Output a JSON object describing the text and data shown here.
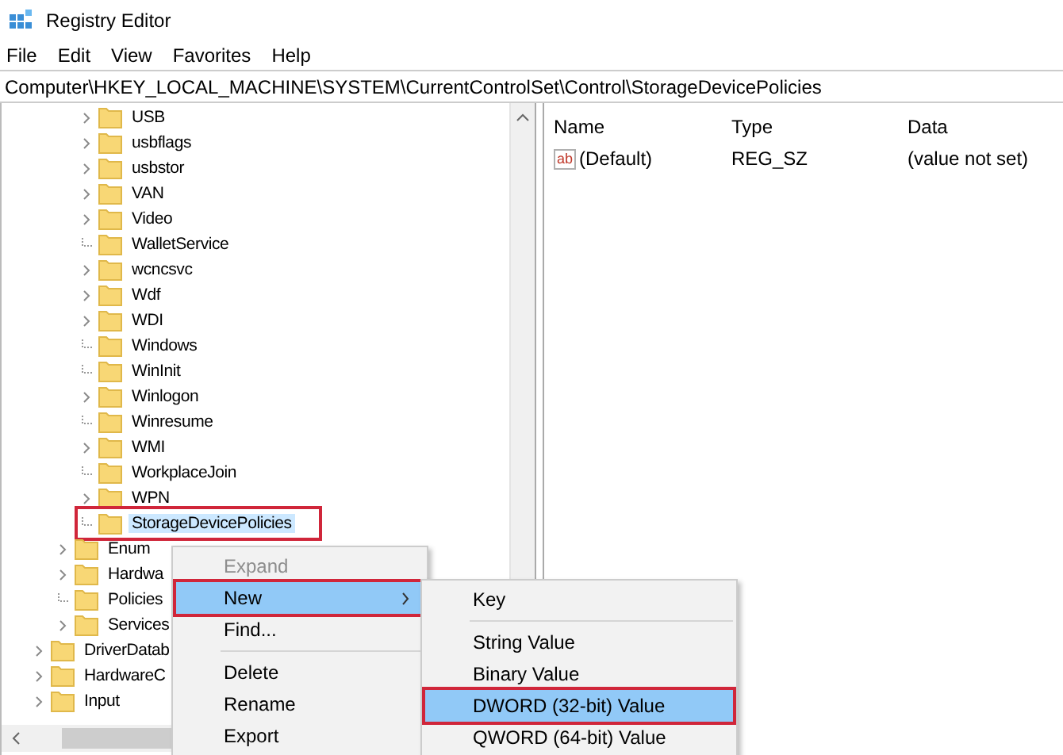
{
  "window": {
    "title": "Registry Editor"
  },
  "menu_bar": [
    "File",
    "Edit",
    "View",
    "Favorites",
    "Help"
  ],
  "address": "Computer\\HKEY_LOCAL_MACHINE\\SYSTEM\\CurrentControlSet\\Control\\StorageDevicePolicies",
  "tree": {
    "children": [
      {
        "children": [
          {
            "children": [
              {
                "label": "USB",
                "expandable": true,
                "selected": false,
                "outlined": false
              },
              {
                "label": "usbflags",
                "expandable": true,
                "selected": false,
                "outlined": false
              },
              {
                "label": "usbstor",
                "expandable": true,
                "selected": false,
                "outlined": false
              },
              {
                "label": "VAN",
                "expandable": true,
                "selected": false,
                "outlined": false
              },
              {
                "label": "Video",
                "expandable": true,
                "selected": false,
                "outlined": false
              },
              {
                "label": "WalletService",
                "expandable": false,
                "selected": false,
                "outlined": false
              },
              {
                "label": "wcncsvc",
                "expandable": true,
                "selected": false,
                "outlined": false
              },
              {
                "label": "Wdf",
                "expandable": true,
                "selected": false,
                "outlined": false
              },
              {
                "label": "WDI",
                "expandable": true,
                "selected": false,
                "outlined": false
              },
              {
                "label": "Windows",
                "expandable": false,
                "selected": false,
                "outlined": false
              },
              {
                "label": "WinInit",
                "expandable": false,
                "selected": false,
                "outlined": false
              },
              {
                "label": "Winlogon",
                "expandable": true,
                "selected": false,
                "outlined": false
              },
              {
                "label": "Winresume",
                "expandable": false,
                "selected": false,
                "outlined": false
              },
              {
                "label": "WMI",
                "expandable": true,
                "selected": false,
                "outlined": false
              },
              {
                "label": "WorkplaceJoin",
                "expandable": false,
                "selected": false,
                "outlined": false
              },
              {
                "label": "WPN",
                "expandable": true,
                "selected": false,
                "outlined": false
              },
              {
                "label": "StorageDevicePolicies",
                "expandable": false,
                "selected": true,
                "outlined": true
              }
            ]
          },
          {
            "label": "Enum",
            "expandable": true,
            "selected": false,
            "outlined": false
          },
          {
            "label": "Hardwa",
            "expandable": true,
            "selected": false,
            "outlined": false
          },
          {
            "label": "Policies",
            "expandable": false,
            "selected": false,
            "outlined": false
          },
          {
            "label": "Services",
            "expandable": true,
            "selected": false,
            "outlined": false
          }
        ]
      },
      {
        "label": "DriverDatab",
        "expandable": true,
        "selected": false,
        "outlined": false
      },
      {
        "label": "HardwareC",
        "expandable": true,
        "selected": false,
        "outlined": false
      },
      {
        "label": "Input",
        "expandable": true,
        "selected": false,
        "outlined": false
      }
    ]
  },
  "values": {
    "columns": [
      "Name",
      "Type",
      "Data"
    ],
    "rows": [
      {
        "icon_text": "ab",
        "name": "(Default)",
        "type": "REG_SZ",
        "data": "(value not set)"
      }
    ]
  },
  "context_menu": {
    "items": [
      {
        "kind": "item",
        "label": "Expand",
        "disabled": true,
        "selected": false,
        "outlined": false,
        "submenu": false
      },
      {
        "kind": "item",
        "label": "New",
        "disabled": false,
        "selected": true,
        "outlined": true,
        "submenu": true
      },
      {
        "kind": "item",
        "label": "Find...",
        "disabled": false,
        "selected": false,
        "outlined": false,
        "submenu": false
      },
      {
        "kind": "separator"
      },
      {
        "kind": "item",
        "label": "Delete",
        "disabled": false,
        "selected": false,
        "outlined": false,
        "submenu": false
      },
      {
        "kind": "item",
        "label": "Rename",
        "disabled": false,
        "selected": false,
        "outlined": false,
        "submenu": false
      },
      {
        "kind": "item",
        "label": "Export",
        "disabled": false,
        "selected": false,
        "outlined": false,
        "submenu": false
      }
    ]
  },
  "submenu": {
    "items": [
      {
        "kind": "item",
        "label": "Key",
        "disabled": false,
        "selected": false,
        "outlined": false,
        "submenu": false
      },
      {
        "kind": "separator"
      },
      {
        "kind": "item",
        "label": "String Value",
        "disabled": false,
        "selected": false,
        "outlined": false,
        "submenu": false
      },
      {
        "kind": "item",
        "label": "Binary Value",
        "disabled": false,
        "selected": false,
        "outlined": false,
        "submenu": false
      },
      {
        "kind": "item",
        "label": "DWORD (32-bit) Value",
        "disabled": false,
        "selected": true,
        "outlined": true,
        "submenu": false
      },
      {
        "kind": "item",
        "label": "QWORD (64-bit) Value",
        "disabled": false,
        "selected": false,
        "outlined": false,
        "submenu": false
      }
    ]
  }
}
